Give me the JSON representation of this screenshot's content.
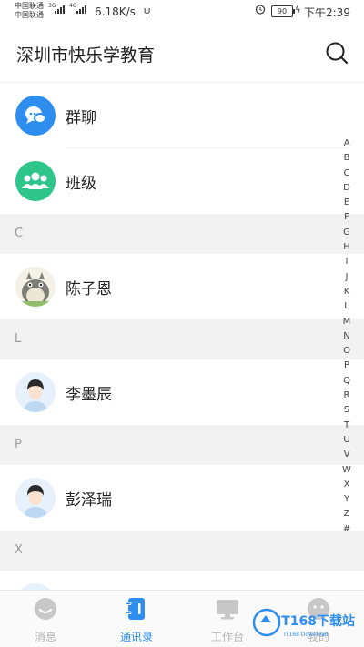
{
  "status_bar": {
    "carrier_1": "中国联通",
    "carrier_2": "中国联通",
    "network_badge_1": "3G",
    "network_badge_2": "4G",
    "speed": "6.18K/s",
    "battery": "90",
    "time": "下午2:39"
  },
  "header": {
    "title": "深圳市快乐学教育"
  },
  "items": {
    "group_chat": "群聊",
    "class": "班级",
    "section_c": "C",
    "contact_1": "陈子恩",
    "section_l": "L",
    "contact_2": "李墨辰",
    "section_p": "P",
    "contact_3": "彭泽瑞",
    "section_x": "X"
  },
  "index_letters": [
    "A",
    "B",
    "C",
    "D",
    "E",
    "F",
    "G",
    "H",
    "I",
    "J",
    "K",
    "L",
    "M",
    "N",
    "O",
    "P",
    "Q",
    "R",
    "S",
    "T",
    "U",
    "V",
    "W",
    "X",
    "Y",
    "Z",
    "#"
  ],
  "tabs": {
    "messages": "消息",
    "contacts": "通讯录",
    "workbench": "工作台",
    "me": "我的"
  },
  "watermark": {
    "text": "IT168下载站",
    "sub": "IT168 Download"
  },
  "colors": {
    "accent": "#2e8ef0",
    "green": "#2ec58a",
    "inactive": "#b5b5b5"
  }
}
